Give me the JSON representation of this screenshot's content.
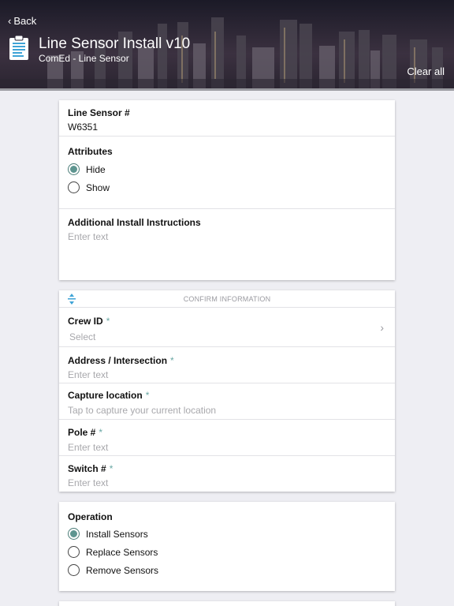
{
  "header": {
    "back_label": "Back",
    "title": "Line Sensor Install v10",
    "subtitle": "ComEd - Line Sensor",
    "clear_all_label": "Clear all",
    "doc_icon": "clipboard-icon"
  },
  "card1": {
    "line_sensor_label": "Line Sensor #",
    "line_sensor_value": "W6351",
    "attributes_label": "Attributes",
    "attributes_options": [
      "Hide",
      "Show"
    ],
    "attributes_selected": "Hide",
    "instructions_label": "Additional Install Instructions",
    "instructions_placeholder": "Enter text"
  },
  "card2": {
    "section_title": "CONFIRM INFORMATION",
    "crew_label": "Crew ID",
    "crew_placeholder": "Select",
    "address_label": "Address / Intersection",
    "address_placeholder": "Enter text",
    "capture_label": "Capture location",
    "capture_placeholder": "Tap to capture your current location",
    "pole_label": "Pole #",
    "pole_placeholder": "Enter text",
    "switch_label": "Switch #",
    "switch_placeholder": "Enter text",
    "required_mark": "*"
  },
  "card3": {
    "operation_label": "Operation",
    "options": [
      "Install Sensors",
      "Replace Sensors",
      "Remove Sensors"
    ],
    "selected": "Install Sensors"
  },
  "colors": {
    "accent": "#5e9590",
    "required": "#6aa8a4",
    "placeholder": "#a8a8ac",
    "background": "#eeeef3"
  }
}
